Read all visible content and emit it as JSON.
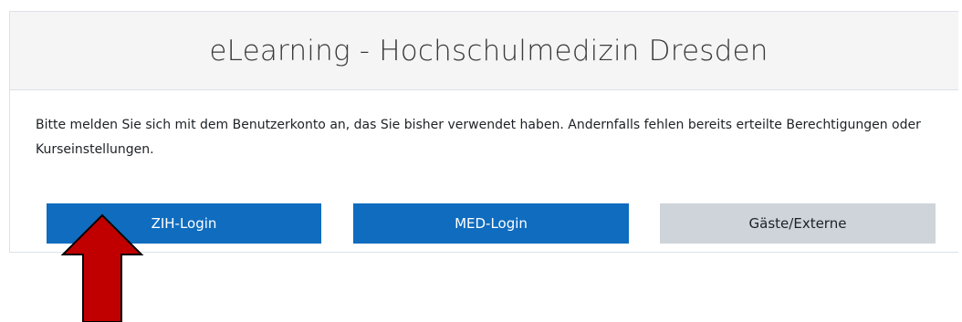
{
  "header": {
    "title": "eLearning - Hochschulmedizin Dresden"
  },
  "body": {
    "info_text": "Bitte melden Sie sich mit dem Benutzerkonto an, das Sie bisher verwendet haben. Andernfalls fehlen bereits erteilte Berechtigungen oder Kurseinstellungen."
  },
  "buttons": {
    "zih_label": "ZIH-Login",
    "med_label": "MED-Login",
    "guest_label": "Gäste/Externe"
  },
  "colors": {
    "primary_button": "#0f6cbf",
    "secondary_button": "#ced4da",
    "header_background": "#f5f5f5",
    "annotation_arrow_fill": "#c00000"
  },
  "annotation": {
    "icon": "red-arrow-up-icon"
  }
}
